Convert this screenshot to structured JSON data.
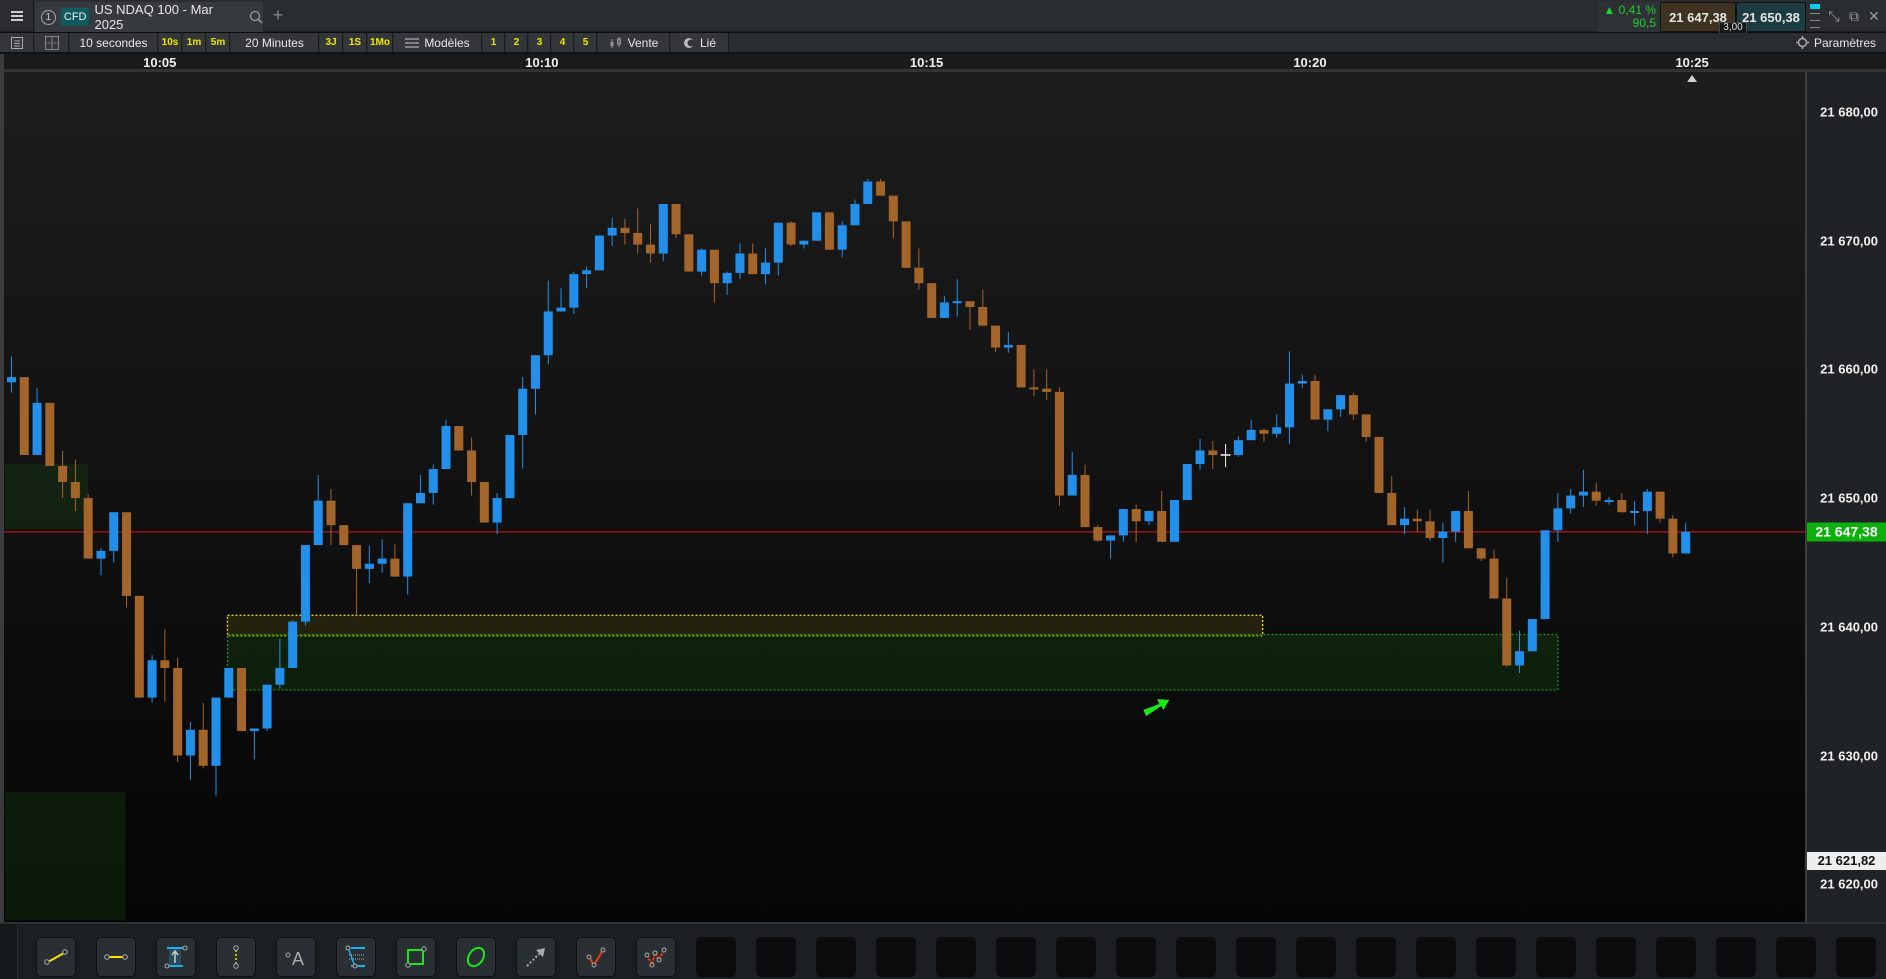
{
  "tab": {
    "index": "1",
    "type_badge": "CFD",
    "title": "US NDAQ 100 - Mar 2025",
    "add_label": "+"
  },
  "quote": {
    "change_pct": "0,41 %",
    "change_pts": "90,5",
    "bid": "21 647,38",
    "ask": "21 650,38",
    "spread": "3,00"
  },
  "toolbar": {
    "interval": "10 secondes",
    "intervals": [
      "10s",
      "1m",
      "5m"
    ],
    "range": "20 Minutes",
    "ranges": [
      "3J",
      "1S",
      "1Mo"
    ],
    "templates": "Modèles",
    "presets": [
      "1",
      "2",
      "3",
      "4",
      "5"
    ],
    "side": "Vente",
    "linked": "Lié",
    "settings": "Paramètres"
  },
  "time_axis": [
    {
      "label": "10:05",
      "candle_index": 11.6
    },
    {
      "label": "10:10",
      "candle_index": 41.5
    },
    {
      "label": "10:15",
      "candle_index": 71.6
    },
    {
      "label": "10:20",
      "candle_index": 101.6
    },
    {
      "label": "10:25",
      "candle_index": 131.5
    }
  ],
  "price_axis": {
    "ticks": [
      "21 680,00",
      "21 670,00",
      "21 660,00",
      "21 650,00",
      "21 640,00",
      "21 630,00",
      "21 620,00"
    ],
    "tick_values": [
      21680,
      21670,
      21660,
      21650,
      21640,
      21630,
      21620
    ],
    "current_label": "21 647,38",
    "current_value": 21647.38,
    "low_label": "21 621,82",
    "low_value": 21621.82
  },
  "colors": {
    "up": "#2290ea",
    "down": "#a3652a",
    "neutral": "#f0f0f0",
    "current_line": "#e01818",
    "current_label": "#0db10d",
    "zone_yellow": "#f5e600",
    "zone_green": "#119911",
    "arrow": "#18e818"
  },
  "chart_data": {
    "type": "candlestick",
    "ylim": [
      21613.3,
      21679.4
    ],
    "neutral_indices": [
      95
    ],
    "ohlc": [
      [
        21659.0,
        21661.0,
        21658.2,
        21659.4
      ],
      [
        21659.4,
        21659.4,
        21653.35,
        21653.35
      ],
      [
        21653.35,
        21658.55,
        21653.35,
        21657.4
      ],
      [
        21657.4,
        21657.4,
        21652.5,
        21652.5
      ],
      [
        21652.5,
        21653.66,
        21650.0,
        21651.25
      ],
      [
        21651.25,
        21653.0,
        21649.0,
        21650.0
      ],
      [
        21650.0,
        21650.3,
        21645.3,
        21645.3
      ],
      [
        21645.3,
        21646.1,
        21644.0,
        21645.9
      ],
      [
        21645.9,
        21648.9,
        21645.0,
        21648.9
      ],
      [
        21648.9,
        21648.9,
        21641.5,
        21642.4
      ],
      [
        21642.4,
        21642.4,
        21634.5,
        21634.5
      ],
      [
        21634.5,
        21637.8,
        21634.1,
        21637.4
      ],
      [
        21637.4,
        21639.8,
        21634.2,
        21636.8
      ],
      [
        21636.8,
        21637.6,
        21629.5,
        21630.0
      ],
      [
        21630.0,
        21632.6,
        21628.1,
        21632.0
      ],
      [
        21632.0,
        21634.1,
        21629.0,
        21629.2
      ],
      [
        21629.2,
        21634.5,
        21626.9,
        21634.5
      ],
      [
        21634.5,
        21636.8,
        21634.5,
        21636.8
      ],
      [
        21636.8,
        21636.8,
        21631.9,
        21631.9
      ],
      [
        21631.9,
        21632.1,
        21629.7,
        21632.1
      ],
      [
        21632.1,
        21635.5,
        21631.9,
        21635.5
      ],
      [
        21635.5,
        21639.1,
        21635.2,
        21636.8
      ],
      [
        21636.8,
        21640.5,
        21636.8,
        21640.4
      ],
      [
        21640.4,
        21646.35,
        21640.1,
        21646.35
      ],
      [
        21646.35,
        21651.8,
        21646.35,
        21649.8
      ],
      [
        21649.8,
        21650.7,
        21646.35,
        21647.9
      ],
      [
        21647.9,
        21647.9,
        21646.35,
        21646.35
      ],
      [
        21646.35,
        21646.35,
        21640.9,
        21644.5
      ],
      [
        21644.5,
        21646.3,
        21643.4,
        21644.9
      ],
      [
        21644.9,
        21646.8,
        21644.2,
        21645.3
      ],
      [
        21645.3,
        21646.4,
        21643.9,
        21643.9
      ],
      [
        21643.9,
        21649.6,
        21642.5,
        21649.6
      ],
      [
        21649.6,
        21651.8,
        21649.6,
        21650.4
      ],
      [
        21650.4,
        21652.6,
        21649.5,
        21652.26
      ],
      [
        21652.26,
        21656.1,
        21652.26,
        21655.6
      ],
      [
        21655.6,
        21655.6,
        21653.7,
        21653.7
      ],
      [
        21653.7,
        21654.7,
        21650.2,
        21651.25
      ],
      [
        21651.25,
        21651.25,
        21648.1,
        21648.1
      ],
      [
        21648.1,
        21650.4,
        21647.2,
        21650.0
      ],
      [
        21650.0,
        21654.9,
        21650.0,
        21654.9
      ],
      [
        21654.9,
        21659.4,
        21652.3,
        21658.5
      ],
      [
        21658.5,
        21661.1,
        21656.5,
        21661.1
      ],
      [
        21661.1,
        21666.9,
        21660.4,
        21664.5
      ],
      [
        21664.5,
        21666.3,
        21664.5,
        21664.8
      ],
      [
        21664.8,
        21667.6,
        21664.3,
        21667.4
      ],
      [
        21667.4,
        21668.0,
        21666.3,
        21667.7
      ],
      [
        21667.7,
        21670.4,
        21667.7,
        21670.4
      ],
      [
        21670.4,
        21671.8,
        21669.6,
        21671.0
      ],
      [
        21671.0,
        21671.7,
        21669.7,
        21670.6
      ],
      [
        21670.6,
        21672.5,
        21669.0,
        21669.7
      ],
      [
        21669.7,
        21671.3,
        21668.3,
        21669.0
      ],
      [
        21669.0,
        21672.85,
        21668.4,
        21672.85
      ],
      [
        21672.85,
        21672.85,
        21670.2,
        21670.5
      ],
      [
        21670.5,
        21670.5,
        21667.6,
        21667.6
      ],
      [
        21667.6,
        21669.4,
        21667.3,
        21669.3
      ],
      [
        21669.3,
        21669.3,
        21665.2,
        21666.7
      ],
      [
        21666.7,
        21667.6,
        21665.8,
        21667.5
      ],
      [
        21667.5,
        21669.8,
        21667.0,
        21669.0
      ],
      [
        21669.0,
        21669.8,
        21667.4,
        21667.4
      ],
      [
        21667.4,
        21669.4,
        21666.6,
        21668.3
      ],
      [
        21668.3,
        21671.4,
        21667.3,
        21671.4
      ],
      [
        21671.4,
        21671.5,
        21669.6,
        21669.7
      ],
      [
        21669.7,
        21670.0,
        21669.4,
        21670.0
      ],
      [
        21670.0,
        21672.2,
        21670.0,
        21672.2
      ],
      [
        21672.2,
        21672.2,
        21669.3,
        21669.3
      ],
      [
        21669.3,
        21671.5,
        21668.7,
        21671.2
      ],
      [
        21671.2,
        21673.2,
        21671.2,
        21672.85
      ],
      [
        21672.85,
        21674.8,
        21672.85,
        21674.6
      ],
      [
        21674.6,
        21674.8,
        21673.5,
        21673.5
      ],
      [
        21673.5,
        21673.5,
        21670.2,
        21671.5
      ],
      [
        21671.5,
        21671.5,
        21667.9,
        21667.9
      ],
      [
        21667.9,
        21669.4,
        21666.2,
        21666.7
      ],
      [
        21666.7,
        21666.7,
        21664.0,
        21664.0
      ],
      [
        21664.0,
        21665.7,
        21664.0,
        21665.2
      ],
      [
        21665.2,
        21667.0,
        21664.1,
        21665.3
      ],
      [
        21665.3,
        21665.3,
        21663.1,
        21664.85
      ],
      [
        21664.85,
        21666.2,
        21663.4,
        21663.4
      ],
      [
        21663.4,
        21663.4,
        21661.35,
        21661.7
      ],
      [
        21661.7,
        21662.9,
        21661.3,
        21661.9
      ],
      [
        21661.9,
        21661.9,
        21658.6,
        21658.6
      ],
      [
        21658.6,
        21660.0,
        21657.9,
        21658.5
      ],
      [
        21658.5,
        21660.0,
        21657.6,
        21658.25
      ],
      [
        21658.25,
        21658.6,
        21649.4,
        21650.2
      ],
      [
        21650.2,
        21653.6,
        21650.2,
        21651.8
      ],
      [
        21651.8,
        21652.6,
        21647.75,
        21647.75
      ],
      [
        21647.75,
        21647.9,
        21646.6,
        21646.7
      ],
      [
        21646.7,
        21647.1,
        21645.3,
        21647.1
      ],
      [
        21647.1,
        21649.15,
        21646.6,
        21649.15
      ],
      [
        21649.15,
        21649.5,
        21646.6,
        21648.2
      ],
      [
        21648.2,
        21649.0,
        21647.9,
        21649.0
      ],
      [
        21649.0,
        21650.55,
        21646.6,
        21646.6
      ],
      [
        21646.6,
        21649.85,
        21646.6,
        21649.85
      ],
      [
        21649.85,
        21652.65,
        21649.85,
        21652.65
      ],
      [
        21652.65,
        21654.6,
        21652.2,
        21653.7
      ],
      [
        21653.7,
        21654.45,
        21652.25,
        21653.35
      ],
      [
        21653.35,
        21654.2,
        21652.4,
        21653.35
      ],
      [
        21653.35,
        21654.8,
        21653.2,
        21654.5
      ],
      [
        21654.5,
        21656.1,
        21654.5,
        21655.3
      ],
      [
        21655.3,
        21655.4,
        21654.36,
        21655.0
      ],
      [
        21655.0,
        21656.5,
        21654.7,
        21655.5
      ],
      [
        21655.5,
        21661.4,
        21654.2,
        21658.9
      ],
      [
        21658.9,
        21659.6,
        21658.55,
        21659.1
      ],
      [
        21659.1,
        21659.6,
        21656.1,
        21656.1
      ],
      [
        21656.1,
        21656.9,
        21655.2,
        21656.9
      ],
      [
        21656.9,
        21658.0,
        21656.3,
        21658.0
      ],
      [
        21658.0,
        21658.2,
        21656.1,
        21656.5
      ],
      [
        21656.5,
        21656.5,
        21654.4,
        21654.75
      ],
      [
        21654.75,
        21654.75,
        21650.4,
        21650.4
      ],
      [
        21650.4,
        21651.7,
        21647.9,
        21647.9
      ],
      [
        21647.9,
        21649.3,
        21647.2,
        21648.4
      ],
      [
        21648.4,
        21649.1,
        21647.4,
        21648.2
      ],
      [
        21648.2,
        21649.1,
        21646.7,
        21646.9
      ],
      [
        21646.9,
        21648.1,
        21645.0,
        21647.4
      ],
      [
        21647.4,
        21649.0,
        21646.6,
        21649.0
      ],
      [
        21649.0,
        21650.55,
        21646.1,
        21646.1
      ],
      [
        21646.1,
        21646.1,
        21645.1,
        21645.3
      ],
      [
        21645.3,
        21646.0,
        21642.2,
        21642.2
      ],
      [
        21642.2,
        21643.8,
        21636.9,
        21637.0
      ],
      [
        21637.0,
        21639.7,
        21636.4,
        21638.1
      ],
      [
        21638.1,
        21640.6,
        21638.1,
        21640.6
      ],
      [
        21640.6,
        21647.5,
        21640.6,
        21647.5
      ],
      [
        21647.5,
        21650.4,
        21646.6,
        21649.2
      ],
      [
        21649.2,
        21650.7,
        21648.8,
        21650.2
      ],
      [
        21650.2,
        21652.2,
        21649.3,
        21650.5
      ],
      [
        21650.5,
        21651.2,
        21649.4,
        21649.8
      ],
      [
        21649.8,
        21650.1,
        21649.5,
        21649.85
      ],
      [
        21649.85,
        21650.4,
        21648.9,
        21648.9
      ],
      [
        21648.9,
        21649.8,
        21647.9,
        21649.0
      ],
      [
        21649.0,
        21650.7,
        21647.2,
        21650.5
      ],
      [
        21650.5,
        21650.5,
        21648.1,
        21648.4
      ],
      [
        21648.4,
        21648.7,
        21645.4,
        21645.7
      ],
      [
        21645.7,
        21648.1,
        21645.7,
        21647.38
      ]
    ],
    "zones": [
      {
        "kind": "yellow",
        "from_index": 16.9,
        "to_index": 97.9,
        "price_high": 21640.9,
        "price_low": 21639.3
      },
      {
        "kind": "green",
        "from_index": 16.9,
        "to_index": 121.0,
        "price_high": 21639.4,
        "price_low": 21635.1
      },
      {
        "kind": "shade",
        "from_index": -0.5,
        "to_index": 6.0,
        "price_high": 21652.65,
        "price_low": 21647.6
      },
      {
        "kind": "shade",
        "from_index": -0.5,
        "to_index": 8.9,
        "price_high": 21627.2,
        "price_low": 21617.2
      }
    ],
    "arrow": {
      "index": 89.5,
      "price": 21634.0
    }
  },
  "drawing_tools": [
    "trend-line",
    "horizontal-segment",
    "price-range",
    "vertical-segment",
    "text",
    "fibonacci",
    "rectangle",
    "ellipse",
    "arrow",
    "polyline",
    "pattern"
  ]
}
